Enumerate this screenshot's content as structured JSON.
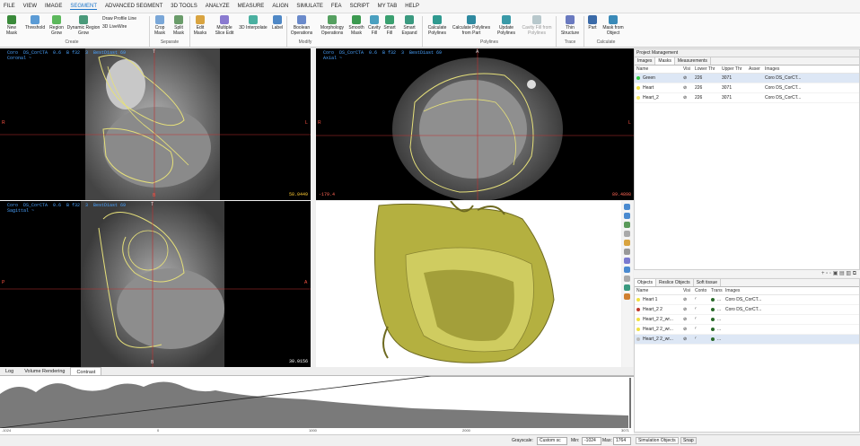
{
  "menu": [
    "FILE",
    "VIEW",
    "IMAGE",
    "SEGMENT",
    "ADVANCED SEGMENT",
    "3D TOOLS",
    "ANALYZE",
    "MEASURE",
    "ALIGN",
    "SIMULATE",
    "FEA",
    "SCRIPT",
    "MY TAB",
    "HELP"
  ],
  "menu_active": "SEGMENT",
  "ribbon": {
    "new_mask": "New\nMask",
    "threshold": "Threshold",
    "dynamic_region_grow": "Dynamic Region\nGrow",
    "region_grow": "Region\nGrow",
    "draw_profile_line": "Draw Profile Line",
    "livewire": "3D LiveWire",
    "group_create": "Create",
    "crop_mask": "Crop\nMask",
    "split_mask": "Split\nMask",
    "group_separate": "Separate",
    "edit_masks": "Edit\nMasks",
    "multiple_slice_edit": "Multiple\nSlice Edit",
    "interpolate_3d": "3D Interpolate",
    "label": "Label",
    "group_modify": "Modify",
    "boolean_operations": "Boolean\nOperations",
    "morphology_operations": "Morphology\nOperations",
    "smooth_mask": "Smooth\nMask",
    "cavity_fill": "Cavity\nFill",
    "smart_fill": "Smart\nFill",
    "smart_expand": "Smart\nExpand",
    "calculate_polylines": "Calculate\nPolylines",
    "calc_polylines_from_part": "Calculate Polylines\nfrom Part",
    "update_polylines": "Update\nPolylines",
    "cavity_fill_from_polylines": "Cavity Fill from\nPolylines",
    "group_polylines": "Polylines",
    "thin_structure": "Thin\nStructure",
    "group_trace": "Trace",
    "part": "Part",
    "mask_from_object": "Mask from\nObject",
    "group_calculate": "Calculate"
  },
  "views": {
    "coronal": {
      "title": "Coro  DS_CorCTA  0.6  B f32  3  BestDiast 69\nCoronal ~",
      "value": "58.0449"
    },
    "axial": {
      "title": "Coro  DS_CorCTA  0.6  B f32  3  BestDiast 69\nAxial ~",
      "value_left": "-179.4",
      "value": "89.4898"
    },
    "sagittal": {
      "title": "Coro  DS_CorCTA  0.6  B f32  3  BestDiast 69\nSagittal ~",
      "value": "30.0156"
    },
    "coronal_top": "T",
    "coronal_bottom": "B",
    "coronal_left": "R",
    "coronal_right": "L",
    "axial_top": "A",
    "axial_left": "R",
    "axial_right": "L",
    "sagittal_top": "T",
    "sagittal_bottom": "B",
    "sagittal_left": "P",
    "sagittal_right": "A"
  },
  "project_management": {
    "title": "Project Management",
    "tabs": [
      "Images",
      "Masks",
      "Measurements"
    ],
    "active_tab": "Masks",
    "columns": [
      "Name",
      "Visi",
      "Lower Thr",
      "Upper Thr",
      "Asser",
      "Images"
    ],
    "rows": [
      {
        "name": "Green",
        "color": "#2ecc40",
        "lower": "226",
        "upper": "3071",
        "image": "Coro DS_CorCT..."
      },
      {
        "name": "Heart",
        "color": "#f0e040",
        "lower": "226",
        "upper": "3071",
        "image": "Coro DS_CorCT..."
      },
      {
        "name": "Heart_2",
        "color": "#f5e96a",
        "lower": "226",
        "upper": "3071",
        "image": "Coro DS_CorCT..."
      }
    ]
  },
  "objects_panel": {
    "tabs": [
      "Objects",
      "Reslice Objects",
      "Soft tissue"
    ],
    "active_tab": "Objects",
    "columns": [
      "Name",
      "Visi",
      "Conto",
      "Trans",
      "Images"
    ],
    "rows": [
      {
        "name": "Heart 1",
        "color": "#f0e040",
        "image": "Coro DS_CorCT..."
      },
      {
        "name": "Heart_2 2",
        "color": "#c0392b",
        "image": "Coro DS_CorCT..."
      },
      {
        "name": "Heart_2 2_wr...",
        "color": "#f0e040",
        "image": ""
      },
      {
        "name": "Heart_2 2_wr...",
        "color": "#f0e040",
        "image": ""
      },
      {
        "name": "Heart_2 2_wr...",
        "color": "#bbbbbb",
        "image": ""
      }
    ]
  },
  "bottom_tabs": [
    "Log",
    "Volume Rendering",
    "Contrast"
  ],
  "bottom_active": "Contrast",
  "histogram_ticks": [
    "-1024",
    "0",
    "1000",
    "2000",
    "3071"
  ],
  "status": {
    "grayscale_label": "Grayscale:",
    "grayscale_value": "Custom sc",
    "min_label": "Min:",
    "min_value": "-1024",
    "max_label": "Max:",
    "max_value": "1764"
  },
  "sim_tabs": [
    "Simulation Objects",
    "Snap"
  ]
}
